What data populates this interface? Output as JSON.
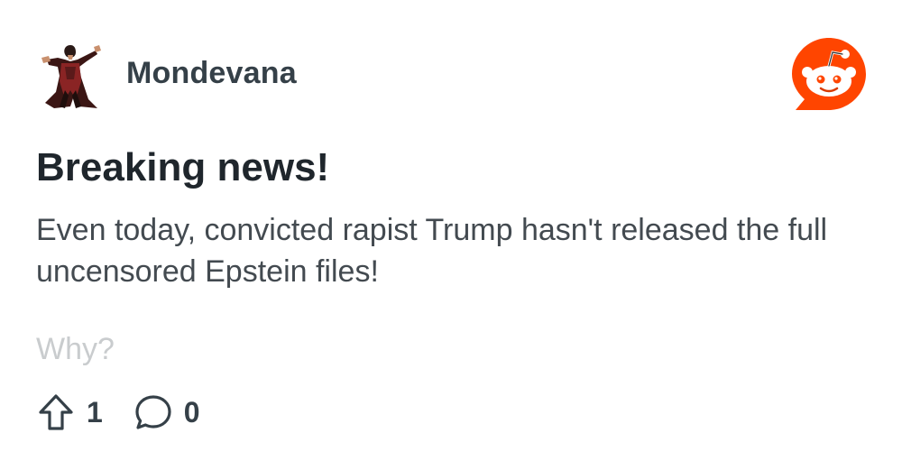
{
  "post": {
    "author": "Mondevana",
    "title": "Breaking news!",
    "body": "Even today, convicted rapist Trump hasn't released the full uncensored Epstein files!",
    "faded_line": "Why?",
    "upvotes": "1",
    "comments": "0"
  },
  "icons": {
    "avatar": "character-avatar",
    "logo": "reddit-logo-icon",
    "upvote": "upvote-arrow-icon",
    "comment": "comment-bubble-icon"
  },
  "colors": {
    "brand_orange": "#ff4500",
    "username": "#354048",
    "title": "#1f262c",
    "body": "#434a50",
    "faded": "#c9ccce"
  }
}
